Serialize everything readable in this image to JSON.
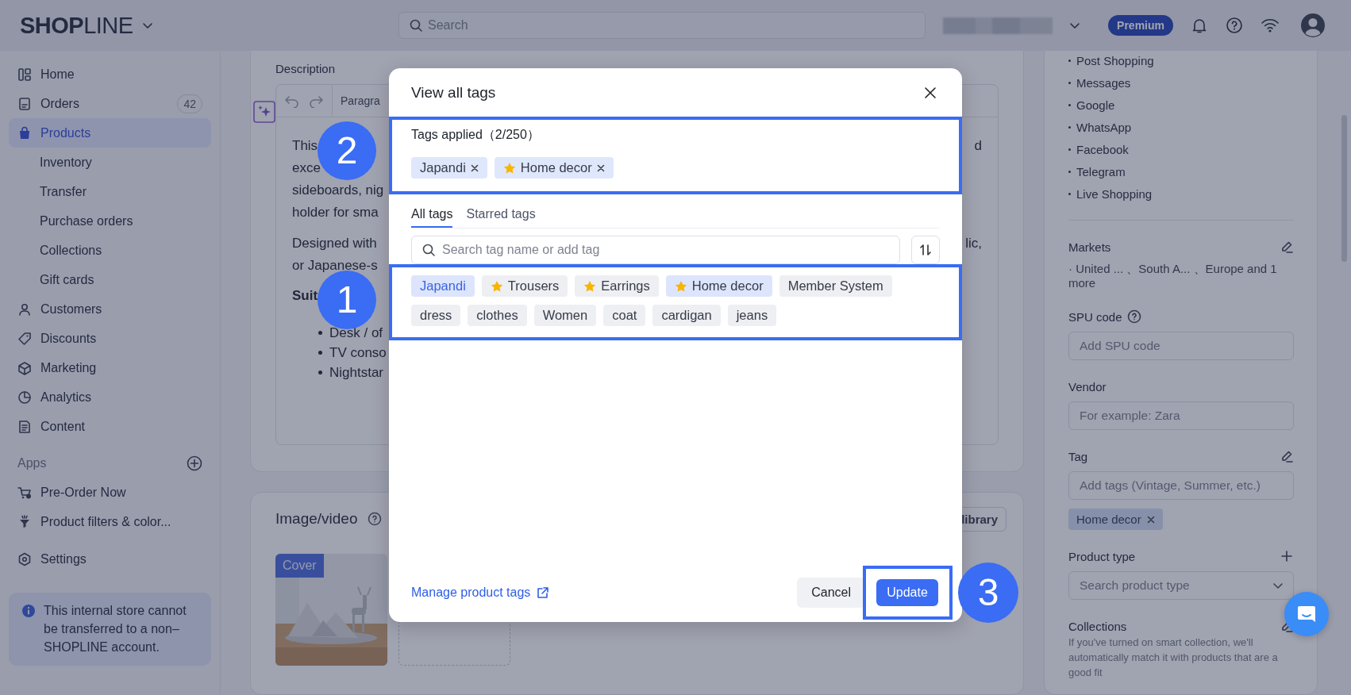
{
  "top_bar": {
    "logo": "**SHOP**LINE",
    "search": {
      "placeholder": "Search"
    },
    "plan_badge": "Premium"
  },
  "sidebar": {
    "items": [
      {
        "label": "Home",
        "selected": false
      },
      {
        "label": "Orders",
        "selected": false,
        "count": "42"
      },
      {
        "label": "Products",
        "selected": true,
        "children": [
          {
            "label": "Inventory",
            "selected": false
          },
          {
            "label": "Transfer",
            "selected": false
          },
          {
            "label": "Purchase orders",
            "selected": false
          },
          {
            "label": "Collections",
            "selected": false
          },
          {
            "label": "Gift cards",
            "selected": false
          }
        ]
      },
      {
        "label": "Customers",
        "selected": false
      },
      {
        "label": "Discounts",
        "selected": false
      },
      {
        "label": "Marketing",
        "selected": false
      },
      {
        "label": "Analytics",
        "selected": false
      },
      {
        "label": "Content",
        "selected": false
      }
    ],
    "apps_heading": "Apps",
    "apps": [
      {
        "label": "Pre-Order Now",
        "selected": false
      },
      {
        "label": "Product filters & color...",
        "selected": false
      }
    ],
    "settings": {
      "label": "Settings",
      "selected": false
    },
    "notice": "This internal store cannot be transferred to a non–SHOPLINE account."
  },
  "description": {
    "label": "Description",
    "toolbar_text": "Paragra",
    "blocks": [
      {
        "kind": "para",
        "lines": [
          {
            "left": "This",
            "right": "d"
          },
          {
            "left": "exce"
          },
          {
            "left": "sideboards, nig"
          },
          {
            "left": "holder for sma"
          }
        ]
      },
      {
        "kind": "para",
        "lines": [
          {
            "left": "Designed with",
            "right": "lic,"
          },
          {
            "left": "or Japanese-s"
          }
        ]
      },
      {
        "kind": "heading",
        "lines": [
          {
            "left": "Suit"
          }
        ]
      },
      {
        "kind": "bullets",
        "lines": [
          {
            "left": "Desk / of"
          },
          {
            "left": "TV conso"
          },
          {
            "left": "Nightstar"
          }
        ]
      }
    ]
  },
  "media": {
    "title": "Image/video",
    "library_button": "library",
    "cover_label": "Cover"
  },
  "right_panel": {
    "channels": [
      "Post Shopping",
      "Messages",
      "Google",
      "WhatsApp",
      "Facebook",
      "Telegram",
      "Live Shopping"
    ],
    "markets": {
      "label": "Markets",
      "value": "· United ... 、South A... 、Europe and 1 more"
    },
    "fields": [
      {
        "label": "SPU code",
        "kind": "input",
        "placeholder": "Add SPU code"
      },
      {
        "label": "Vendor",
        "kind": "input",
        "placeholder": "For example: Zara"
      },
      {
        "label": "Tag",
        "kind": "input",
        "placeholder": "Add tags (Vintage, Summer, etc.)",
        "tags": [
          "Home decor"
        ]
      },
      {
        "label": "Product type",
        "kind": "select",
        "placeholder": "Search product type"
      },
      {
        "label": "Collections",
        "kind": "note",
        "note": "If you've turned on smart collection, we'll automatically match it with products that are a good fit"
      }
    ]
  },
  "modal": {
    "title": "View all tags",
    "applied": {
      "label": "Tags applied（2/250）",
      "highlighted": true,
      "tags": [
        {
          "label": "Japandi",
          "starred": false
        },
        {
          "label": "Home decor",
          "starred": true
        }
      ]
    },
    "tabs": [
      {
        "label": "All tags",
        "selected": true
      },
      {
        "label": "Starred tags",
        "selected": false
      }
    ],
    "search": {
      "placeholder": "Search tag name or add tag"
    },
    "tag_list": {
      "highlighted": true,
      "tags": [
        {
          "label": "Japandi",
          "starred": false,
          "selected": true
        },
        {
          "label": "Trousers",
          "starred": true,
          "selected": false
        },
        {
          "label": "Earrings",
          "starred": true,
          "selected": false
        },
        {
          "label": "Home decor",
          "starred": true,
          "selected": true
        },
        {
          "label": "Member System",
          "starred": false,
          "selected": false
        },
        {
          "label": "dress",
          "starred": false,
          "selected": false
        },
        {
          "label": "clothes",
          "starred": false,
          "selected": false
        },
        {
          "label": "Women",
          "starred": false,
          "selected": false
        },
        {
          "label": "coat",
          "starred": false,
          "selected": false
        },
        {
          "label": "cardigan",
          "starred": false,
          "selected": false
        },
        {
          "label": "jeans",
          "starred": false,
          "selected": false
        }
      ]
    },
    "link": "Manage product tags",
    "cancel": "Cancel",
    "update": {
      "label": "Update",
      "highlighted": true
    }
  },
  "callouts": [
    "1",
    "2",
    "3"
  ]
}
